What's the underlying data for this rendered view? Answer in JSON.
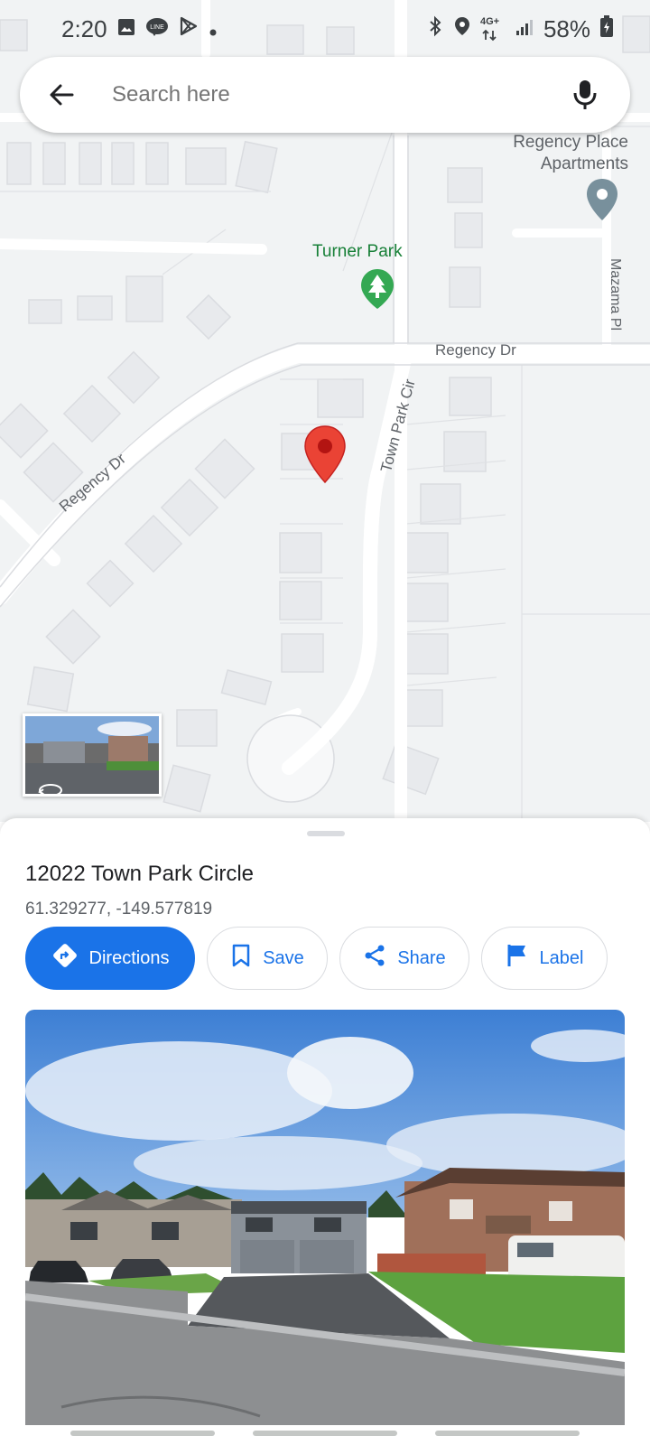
{
  "status_bar": {
    "time": "2:20",
    "icons_left": [
      "image-icon",
      "line-app-icon",
      "play-store-icon",
      "dot-icon"
    ],
    "icons_right": [
      "bluetooth-icon",
      "location-icon",
      "4g-icon",
      "signal-icon",
      "battery-icon"
    ],
    "network": "4G+",
    "battery": "58%"
  },
  "search": {
    "placeholder": "Search here"
  },
  "map": {
    "labels": {
      "apartments_line1": "Regency Place",
      "apartments_line2": "Apartments",
      "park": "Turner Park",
      "regency_dr_east": "Regency Dr",
      "regency_dr_west": "Regency Dr",
      "town_park_cir": "Town Park Cir",
      "mazama_pl": "Mazama Pl"
    }
  },
  "place": {
    "title": "12022 Town Park Circle",
    "coordinates": "61.329277, -149.577819"
  },
  "actions": {
    "directions": "Directions",
    "save": "Save",
    "share": "Share",
    "label": "Label"
  },
  "colors": {
    "accent": "#1a73e8",
    "pin": "#ea4335",
    "park": "#188038",
    "map_bg": "#f1f3f4"
  }
}
